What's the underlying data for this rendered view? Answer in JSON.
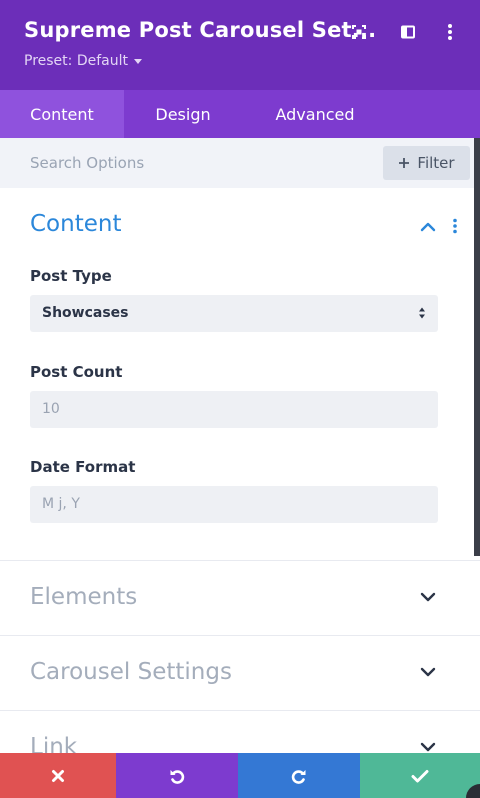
{
  "header": {
    "title": "Supreme Post Carousel Set...",
    "preset": "Preset: Default",
    "icons": [
      "focus-mode-icon",
      "sidebar-layout-icon",
      "more-vertical-icon"
    ],
    "background": "#6c2eb9"
  },
  "tabs": [
    {
      "label": "Content",
      "active": true
    },
    {
      "label": "Design",
      "active": false
    },
    {
      "label": "Advanced",
      "active": false
    }
  ],
  "search": {
    "placeholder": "Search Options",
    "filter_label": "Filter"
  },
  "content_section": {
    "title": "Content",
    "fields": {
      "post_type": {
        "label": "Post Type",
        "value": "Showcases"
      },
      "post_count": {
        "label": "Post Count",
        "value": "10"
      },
      "date_format": {
        "label": "Date Format",
        "value": "M j, Y"
      }
    }
  },
  "collapsed_sections": [
    {
      "title": "Elements"
    },
    {
      "title": "Carousel Settings"
    },
    {
      "title": "Link"
    }
  ],
  "bottom_bar": {
    "buttons": [
      "discard-icon",
      "undo-icon",
      "redo-icon",
      "save-icon"
    ],
    "colors": {
      "discard": "#e05252",
      "undo": "#7d3bcf",
      "redo": "#3478d4",
      "save": "#4fb897"
    }
  },
  "accent_color": "#2b87da"
}
